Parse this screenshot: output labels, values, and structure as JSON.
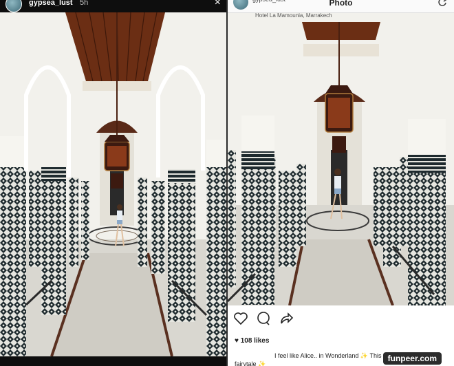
{
  "left_story": {
    "username": "gypsea_lust",
    "time": "5h",
    "close_glyph": "×",
    "icons": [
      "avatar",
      "close-icon"
    ]
  },
  "right_post": {
    "header_title": "Photo",
    "username": "gypsea_lust",
    "location": "Hotel La Mamounia, Marrakech",
    "likes": "108 likes",
    "caption_line1": "I feel like Alice.. in Wonderland ✨ This place is a",
    "caption_line2": "fairytale ✨",
    "icons": [
      "heart-icon",
      "comment-icon",
      "share-icon",
      "refresh-icon"
    ]
  },
  "watermark": "funpeer.com",
  "colors": {
    "tile_dark": "#1e2a2e",
    "tile_light": "#e6e6e0",
    "ceiling": "#6b2e14",
    "wall": "#f2f1ec",
    "floor": "#d9d7d0"
  }
}
